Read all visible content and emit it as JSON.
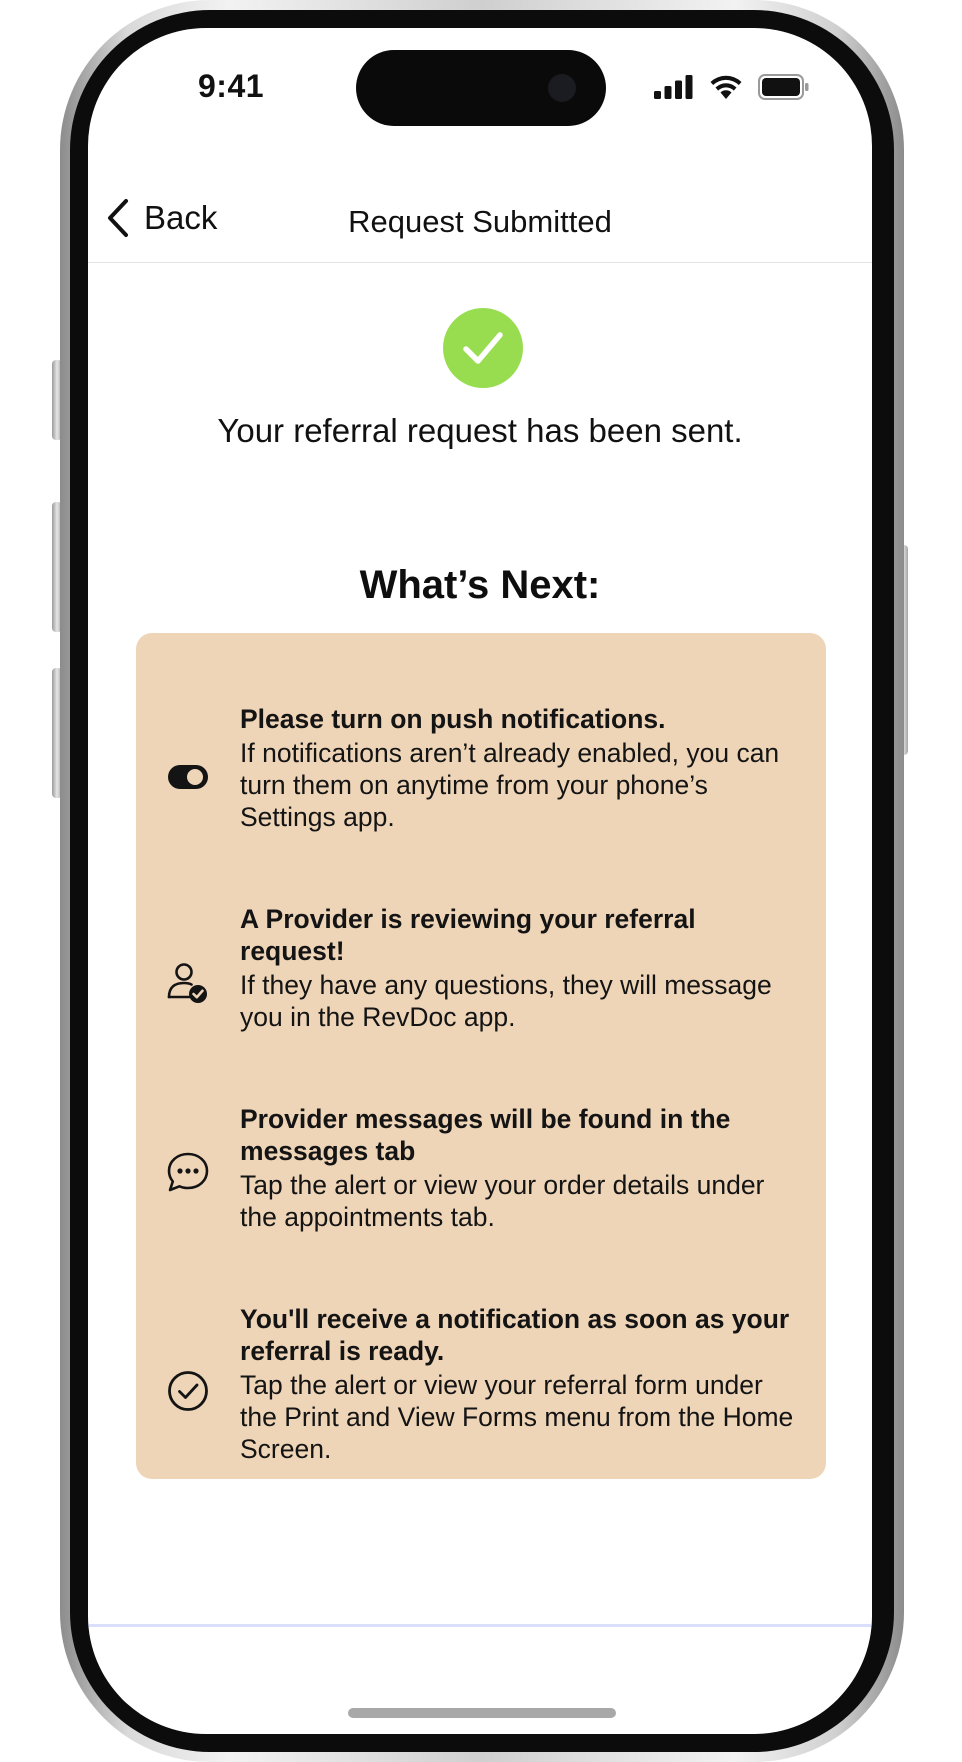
{
  "status_bar": {
    "time": "9:41"
  },
  "nav": {
    "back_label": "Back",
    "title": "Request Submitted"
  },
  "confirmation": {
    "message": "Your referral request has been sent.",
    "icon": "check-circle-icon",
    "icon_color": "#97dd4f"
  },
  "whats_next": {
    "heading": "What’s Next:",
    "card_color": "#efd5b8",
    "steps": [
      {
        "icon": "toggle-icon",
        "title": "Please turn on push notifications.",
        "body": "If notifications aren’t already enabled, you can turn them on anytime from your phone’s Settings app."
      },
      {
        "icon": "user-check-icon",
        "title": "A Provider is reviewing your referral request!",
        "body": "If they have any questions, they will message you in the RevDoc app."
      },
      {
        "icon": "chat-bubble-icon",
        "title": "Provider messages will be found in the messages tab",
        "body": "Tap the alert or view your order details under the appointments tab."
      },
      {
        "icon": "check-circle-outline-icon",
        "title": "You'll receive a notification as soon as your referral is ready.",
        "body": "Tap the alert or view your referral form under the Print and View Forms menu from the Home Screen."
      }
    ]
  }
}
